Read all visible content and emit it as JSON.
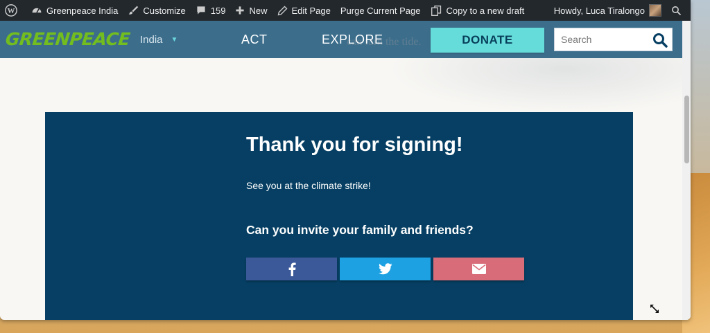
{
  "adminbar": {
    "site_name": "Greenpeace India",
    "customize": "Customize",
    "comments_count": "159",
    "new_label": "New",
    "edit_page": "Edit Page",
    "purge": "Purge Current Page",
    "copy_draft": "Copy to a new draft",
    "howdy": "Howdy, Luca Tiralongo"
  },
  "header": {
    "logo": "GREENPEACE",
    "country": "India",
    "nav": [
      "ACT",
      "EXPLORE"
    ],
    "donate": "DONATE",
    "search_placeholder": "Search",
    "ghost_text": "can turn the tide."
  },
  "card": {
    "title": "Thank you for signing!",
    "subtitle": "See you at the climate strike!",
    "ask": "Can you invite your family and friends?",
    "share_buttons": [
      "facebook-icon",
      "twitter-icon",
      "email-icon"
    ]
  },
  "colors": {
    "adminbar": "#23282d",
    "header": "#3c6e8c",
    "logo": "#73be1e",
    "donate": "#66dcda",
    "card": "#063f63",
    "facebook": "#3b5998",
    "twitter": "#1da1e2",
    "email": "#d86c78"
  }
}
